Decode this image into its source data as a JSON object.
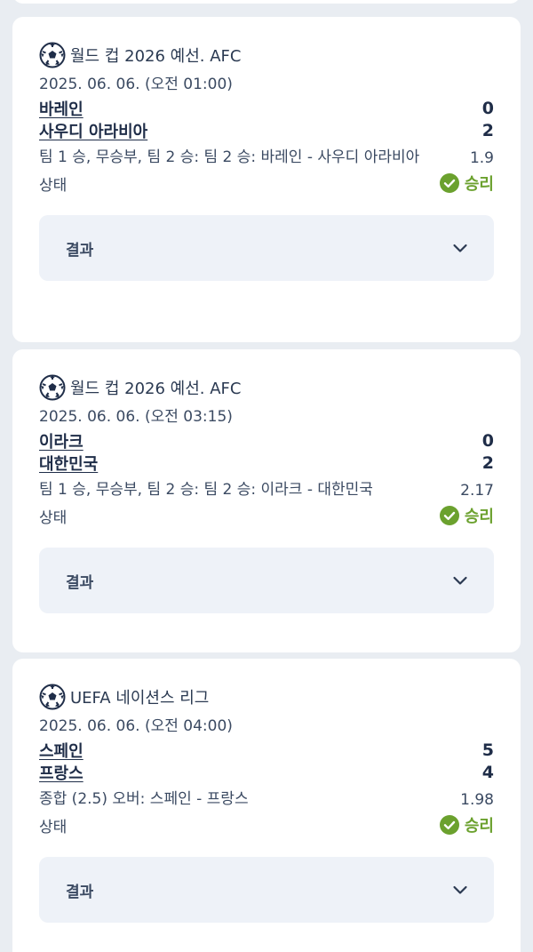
{
  "matches": [
    {
      "league": "월드 컵 2026 예선. AFC",
      "date": "2025. 06. 06. (오전 01:00)",
      "team1": "바레인",
      "score1": "0",
      "team2": "사우디 아라비아",
      "score2": "2",
      "bet": "팀 1 승, 무승부, 팀 2 승: 팀 2 승: 바레인 - 사우디 아라비아",
      "odds": "1.9",
      "status_label": "상태",
      "status": "승리",
      "result_label": "결과"
    },
    {
      "league": "월드 컵 2026 예선. AFC",
      "date": "2025. 06. 06. (오전 03:15)",
      "team1": "이라크",
      "score1": "0",
      "team2": "대한민국",
      "score2": "2",
      "bet": "팀 1 승, 무승부, 팀 2 승: 팀 2 승: 이라크 - 대한민국",
      "odds": "2.17",
      "status_label": "상태",
      "status": "승리",
      "result_label": "결과"
    },
    {
      "league": "UEFA 네이션스 리그",
      "date": "2025. 06. 06. (오전 04:00)",
      "team1": "스페인",
      "score1": "5",
      "team2": "프랑스",
      "score2": "4",
      "bet": "종합 (2.5) 오버: 스페인 - 프랑스",
      "odds": "1.98",
      "status_label": "상태",
      "status": "승리",
      "result_label": "결과"
    }
  ],
  "colors": {
    "win": "#6ba12e",
    "text": "#2b3a52",
    "result_bg": "#eef2f8",
    "page_bg": "#e9edf2"
  },
  "icons": {
    "sport": "soccer-ball-icon",
    "status": "check-circle-icon",
    "expand": "chevron-down-icon"
  }
}
